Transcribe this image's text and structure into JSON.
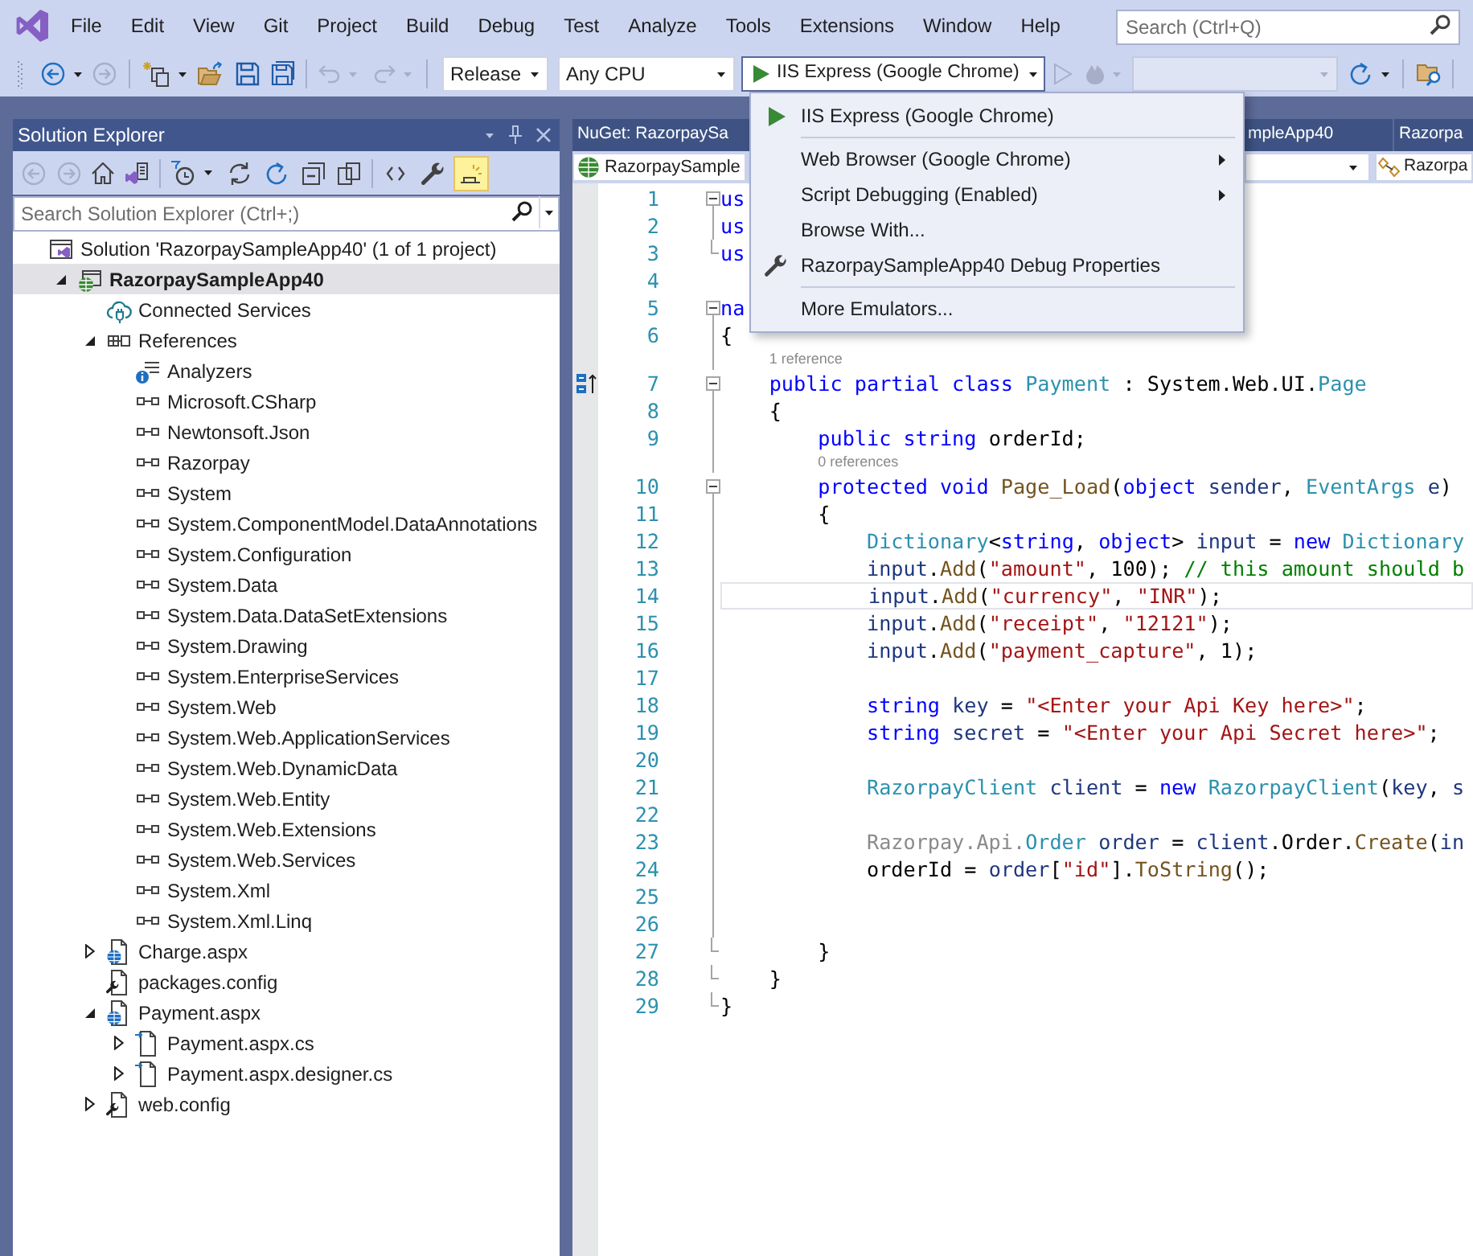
{
  "menu_bar": {
    "items": [
      "File",
      "Edit",
      "View",
      "Git",
      "Project",
      "Build",
      "Debug",
      "Test",
      "Analyze",
      "Tools",
      "Extensions",
      "Window",
      "Help"
    ],
    "search": {
      "placeholder": "Search (Ctrl+Q)"
    }
  },
  "toolbar": {
    "navigate_back": {
      "disabled": false
    },
    "navigate_forward": {
      "disabled": true
    },
    "undo": {
      "disabled": true
    },
    "redo": {
      "disabled": true
    },
    "configuration": {
      "value": "Release"
    },
    "platform": {
      "value": "Any CPU"
    },
    "run": {
      "label": "IIS Express (Google Chrome)",
      "expanded": true
    },
    "start_without_debugging": {
      "disabled": true
    },
    "hot_reload": {
      "disabled": true
    },
    "debug_target": {
      "disabled": true
    }
  },
  "run_menu": {
    "items": [
      {
        "kind": "launch",
        "label": "IIS Express (Google Chrome)",
        "submenu": false
      },
      {
        "kind": "separator"
      },
      {
        "kind": "command",
        "label": "Web Browser (Google Chrome)",
        "submenu": true
      },
      {
        "kind": "command",
        "label": "Script Debugging (Enabled)",
        "submenu": true
      },
      {
        "kind": "command",
        "label": "Browse With...",
        "submenu": false
      },
      {
        "kind": "properties",
        "label": "RazorpaySampleApp40 Debug Properties",
        "submenu": false
      },
      {
        "kind": "separator"
      },
      {
        "kind": "command",
        "label": "More Emulators...",
        "submenu": false
      }
    ]
  },
  "solution_explorer": {
    "title": "Solution Explorer",
    "toolbar": {
      "back": {
        "disabled": true
      },
      "forward": {
        "disabled": true
      },
      "preview_selected_items": {
        "on": true
      }
    },
    "search": {
      "placeholder": "Search Solution Explorer (Ctrl+;)"
    },
    "tree": [
      {
        "label": "Solution 'RazorpaySampleApp40' (1 of 1 project)",
        "kind": "solution",
        "selected": false,
        "children": [
          {
            "label": "RazorpaySampleApp40",
            "kind": "web-project",
            "selected": true,
            "expanded": true,
            "children": [
              {
                "label": "Connected Services",
                "kind": "connected-services",
                "selected": false
              },
              {
                "label": "References",
                "kind": "references",
                "selected": false,
                "expanded": true,
                "children": [
                  {
                    "label": "Analyzers",
                    "kind": "analyzers",
                    "selected": false
                  },
                  {
                    "label": "Microsoft.CSharp",
                    "kind": "assembly",
                    "selected": false
                  },
                  {
                    "label": "Newtonsoft.Json",
                    "kind": "assembly",
                    "selected": false
                  },
                  {
                    "label": "Razorpay",
                    "kind": "assembly",
                    "selected": false
                  },
                  {
                    "label": "System",
                    "kind": "assembly",
                    "selected": false
                  },
                  {
                    "label": "System.ComponentModel.DataAnnotations",
                    "kind": "assembly",
                    "selected": false
                  },
                  {
                    "label": "System.Configuration",
                    "kind": "assembly",
                    "selected": false
                  },
                  {
                    "label": "System.Data",
                    "kind": "assembly",
                    "selected": false
                  },
                  {
                    "label": "System.Data.DataSetExtensions",
                    "kind": "assembly",
                    "selected": false
                  },
                  {
                    "label": "System.Drawing",
                    "kind": "assembly",
                    "selected": false
                  },
                  {
                    "label": "System.EnterpriseServices",
                    "kind": "assembly",
                    "selected": false
                  },
                  {
                    "label": "System.Web",
                    "kind": "assembly",
                    "selected": false
                  },
                  {
                    "label": "System.Web.ApplicationServices",
                    "kind": "assembly",
                    "selected": false
                  },
                  {
                    "label": "System.Web.DynamicData",
                    "kind": "assembly",
                    "selected": false
                  },
                  {
                    "label": "System.Web.Entity",
                    "kind": "assembly",
                    "selected": false
                  },
                  {
                    "label": "System.Web.Extensions",
                    "kind": "assembly",
                    "selected": false
                  },
                  {
                    "label": "System.Web.Services",
                    "kind": "assembly",
                    "selected": false
                  },
                  {
                    "label": "System.Xml",
                    "kind": "assembly",
                    "selected": false
                  },
                  {
                    "label": "System.Xml.Linq",
                    "kind": "assembly",
                    "selected": false
                  }
                ]
              },
              {
                "label": "Charge.aspx",
                "kind": "web-file",
                "selected": false,
                "expanded": false
              },
              {
                "label": "packages.config",
                "kind": "config-file",
                "selected": false
              },
              {
                "label": "Payment.aspx",
                "kind": "web-file",
                "selected": false,
                "expanded": true,
                "children": [
                  {
                    "label": "Payment.aspx.cs",
                    "kind": "code-file",
                    "selected": false,
                    "expanded": false
                  },
                  {
                    "label": "Payment.aspx.designer.cs",
                    "kind": "code-file",
                    "selected": false,
                    "expanded": false
                  }
                ]
              },
              {
                "label": "web.config",
                "kind": "config-file",
                "selected": false,
                "expanded": false
              }
            ]
          }
        ]
      }
    ]
  },
  "editor": {
    "tabs": [
      {
        "label": "NuGet: RazorpaySa",
        "selected": false
      },
      {
        "label": "mpleApp40",
        "selected": false
      },
      {
        "label": "Razorpa",
        "selected": false
      }
    ],
    "navigation": {
      "project": "RazorpaySample",
      "member": "Razorpa"
    },
    "lines": [
      {
        "kind": "code",
        "number": "1",
        "tokens": [
          {
            "text": "us",
            "kind": "keyword"
          }
        ],
        "expanded": true,
        "fold_end": false,
        "current": false,
        "marker": false
      },
      {
        "kind": "code",
        "number": "2",
        "tokens": [
          {
            "text": "us",
            "kind": "keyword"
          }
        ],
        "fold_end": false,
        "current": false,
        "marker": false
      },
      {
        "kind": "code",
        "number": "3",
        "tokens": [
          {
            "text": "us",
            "kind": "keyword"
          }
        ],
        "fold_end": true,
        "current": false,
        "marker": false
      },
      {
        "kind": "code",
        "number": "4",
        "fold_end": false,
        "current": false,
        "marker": false
      },
      {
        "kind": "code",
        "number": "5",
        "tokens": [
          {
            "text": "na",
            "kind": "keyword"
          }
        ],
        "expanded": true,
        "fold_end": false,
        "current": false,
        "marker": false
      },
      {
        "kind": "code",
        "number": "6",
        "tokens": [
          {
            "text": "{",
            "kind": "plain"
          }
        ],
        "fold_end": false,
        "current": false,
        "marker": false,
        "children": [
          {
            "kind": "codelens",
            "text": "1 reference"
          },
          {
            "kind": "code",
            "number": "7",
            "tokens": [
              {
                "text": "public partial class ",
                "kind": "keyword"
              },
              {
                "text": "Payment",
                "kind": "type"
              },
              {
                "text": " : System.Web.UI.",
                "kind": "plain"
              },
              {
                "text": "Page",
                "kind": "type"
              }
            ],
            "expanded": true,
            "fold_end": false,
            "current": false,
            "marker": true
          },
          {
            "kind": "code",
            "number": "8",
            "tokens": [
              {
                "text": "{",
                "kind": "plain"
              }
            ],
            "fold_end": false,
            "current": false,
            "marker": false,
            "children": [
              {
                "kind": "code",
                "number": "9",
                "tokens": [
                  {
                    "text": "public string",
                    "kind": "keyword"
                  },
                  {
                    "text": " orderId;",
                    "kind": "plain"
                  }
                ],
                "fold_end": false,
                "current": false,
                "marker": false
              },
              {
                "kind": "codelens",
                "text": "0 references"
              },
              {
                "kind": "code",
                "number": "10",
                "tokens": [
                  {
                    "text": "protected void ",
                    "kind": "keyword"
                  },
                  {
                    "text": "Page_Load",
                    "kind": "method"
                  },
                  {
                    "text": "(",
                    "kind": "plain"
                  },
                  {
                    "text": "object ",
                    "kind": "keyword"
                  },
                  {
                    "text": "sender",
                    "kind": "local"
                  },
                  {
                    "text": ", ",
                    "kind": "plain"
                  },
                  {
                    "text": "EventArgs ",
                    "kind": "type"
                  },
                  {
                    "text": "e",
                    "kind": "local"
                  },
                  {
                    "text": ")",
                    "kind": "plain"
                  }
                ],
                "expanded": true,
                "fold_end": false,
                "current": false,
                "marker": false
              },
              {
                "kind": "code",
                "number": "11",
                "tokens": [
                  {
                    "text": "{",
                    "kind": "plain"
                  }
                ],
                "fold_end": false,
                "current": false,
                "marker": false,
                "children": [
                  {
                    "kind": "code",
                    "number": "12",
                    "tokens": [
                      {
                        "text": "Dictionary",
                        "kind": "type"
                      },
                      {
                        "text": "<",
                        "kind": "plain"
                      },
                      {
                        "text": "string",
                        "kind": "keyword"
                      },
                      {
                        "text": ", ",
                        "kind": "plain"
                      },
                      {
                        "text": "object",
                        "kind": "keyword"
                      },
                      {
                        "text": "> ",
                        "kind": "plain"
                      },
                      {
                        "text": "input",
                        "kind": "local"
                      },
                      {
                        "text": " = ",
                        "kind": "plain"
                      },
                      {
                        "text": "new ",
                        "kind": "keyword"
                      },
                      {
                        "text": "Dictionary",
                        "kind": "type"
                      }
                    ],
                    "fold_end": false,
                    "current": false,
                    "marker": false
                  },
                  {
                    "kind": "code",
                    "number": "13",
                    "tokens": [
                      {
                        "text": "input",
                        "kind": "local"
                      },
                      {
                        "text": ".",
                        "kind": "plain"
                      },
                      {
                        "text": "Add",
                        "kind": "method"
                      },
                      {
                        "text": "(",
                        "kind": "plain"
                      },
                      {
                        "text": "\"amount\"",
                        "kind": "string"
                      },
                      {
                        "text": ", 100); ",
                        "kind": "plain"
                      },
                      {
                        "text": "// this amount should b",
                        "kind": "comment"
                      }
                    ],
                    "fold_end": false,
                    "current": false,
                    "marker": false
                  },
                  {
                    "kind": "code",
                    "number": "14",
                    "tokens": [
                      {
                        "text": "input",
                        "kind": "local"
                      },
                      {
                        "text": ".",
                        "kind": "plain"
                      },
                      {
                        "text": "Add",
                        "kind": "method"
                      },
                      {
                        "text": "(",
                        "kind": "plain"
                      },
                      {
                        "text": "\"currency\"",
                        "kind": "string"
                      },
                      {
                        "text": ", ",
                        "kind": "plain"
                      },
                      {
                        "text": "\"INR\"",
                        "kind": "string"
                      },
                      {
                        "text": ");",
                        "kind": "plain"
                      }
                    ],
                    "fold_end": false,
                    "current": true,
                    "marker": false
                  },
                  {
                    "kind": "code",
                    "number": "15",
                    "tokens": [
                      {
                        "text": "input",
                        "kind": "local"
                      },
                      {
                        "text": ".",
                        "kind": "plain"
                      },
                      {
                        "text": "Add",
                        "kind": "method"
                      },
                      {
                        "text": "(",
                        "kind": "plain"
                      },
                      {
                        "text": "\"receipt\"",
                        "kind": "string"
                      },
                      {
                        "text": ", ",
                        "kind": "plain"
                      },
                      {
                        "text": "\"12121\"",
                        "kind": "string"
                      },
                      {
                        "text": ");",
                        "kind": "plain"
                      }
                    ],
                    "fold_end": false,
                    "current": false,
                    "marker": false
                  },
                  {
                    "kind": "code",
                    "number": "16",
                    "tokens": [
                      {
                        "text": "input",
                        "kind": "local"
                      },
                      {
                        "text": ".",
                        "kind": "plain"
                      },
                      {
                        "text": "Add",
                        "kind": "method"
                      },
                      {
                        "text": "(",
                        "kind": "plain"
                      },
                      {
                        "text": "\"payment_capture\"",
                        "kind": "string"
                      },
                      {
                        "text": ", 1);",
                        "kind": "plain"
                      }
                    ],
                    "fold_end": false,
                    "current": false,
                    "marker": false
                  },
                  {
                    "kind": "code",
                    "number": "17",
                    "fold_end": false,
                    "current": false,
                    "marker": false
                  },
                  {
                    "kind": "code",
                    "number": "18",
                    "tokens": [
                      {
                        "text": "string ",
                        "kind": "keyword"
                      },
                      {
                        "text": "key",
                        "kind": "local"
                      },
                      {
                        "text": " = ",
                        "kind": "plain"
                      },
                      {
                        "text": "\"<Enter your Api Key here>\"",
                        "kind": "string"
                      },
                      {
                        "text": ";",
                        "kind": "plain"
                      }
                    ],
                    "fold_end": false,
                    "current": false,
                    "marker": false
                  },
                  {
                    "kind": "code",
                    "number": "19",
                    "tokens": [
                      {
                        "text": "string ",
                        "kind": "keyword"
                      },
                      {
                        "text": "secret",
                        "kind": "local"
                      },
                      {
                        "text": " = ",
                        "kind": "plain"
                      },
                      {
                        "text": "\"<Enter your Api Secret here>\"",
                        "kind": "string"
                      },
                      {
                        "text": ";",
                        "kind": "plain"
                      }
                    ],
                    "fold_end": false,
                    "current": false,
                    "marker": false
                  },
                  {
                    "kind": "code",
                    "number": "20",
                    "fold_end": false,
                    "current": false,
                    "marker": false
                  },
                  {
                    "kind": "code",
                    "number": "21",
                    "tokens": [
                      {
                        "text": "RazorpayClient ",
                        "kind": "type"
                      },
                      {
                        "text": "client",
                        "kind": "local"
                      },
                      {
                        "text": " = ",
                        "kind": "plain"
                      },
                      {
                        "text": "new ",
                        "kind": "keyword"
                      },
                      {
                        "text": "RazorpayClient",
                        "kind": "type"
                      },
                      {
                        "text": "(",
                        "kind": "plain"
                      },
                      {
                        "text": "key",
                        "kind": "local"
                      },
                      {
                        "text": ", ",
                        "kind": "plain"
                      },
                      {
                        "text": "s",
                        "kind": "local"
                      }
                    ],
                    "fold_end": false,
                    "current": false,
                    "marker": false
                  },
                  {
                    "kind": "code",
                    "number": "22",
                    "fold_end": false,
                    "current": false,
                    "marker": false
                  },
                  {
                    "kind": "code",
                    "number": "23",
                    "tokens": [
                      {
                        "text": "Razorpay.Api.",
                        "kind": "dim"
                      },
                      {
                        "text": "Order ",
                        "kind": "type"
                      },
                      {
                        "text": "order",
                        "kind": "local"
                      },
                      {
                        "text": " = ",
                        "kind": "plain"
                      },
                      {
                        "text": "client",
                        "kind": "local"
                      },
                      {
                        "text": ".Order.",
                        "kind": "plain"
                      },
                      {
                        "text": "Create",
                        "kind": "method"
                      },
                      {
                        "text": "(",
                        "kind": "plain"
                      },
                      {
                        "text": "in",
                        "kind": "local"
                      }
                    ],
                    "fold_end": false,
                    "current": false,
                    "marker": false
                  },
                  {
                    "kind": "code",
                    "number": "24",
                    "tokens": [
                      {
                        "text": "orderId",
                        "kind": "plain"
                      },
                      {
                        "text": " = ",
                        "kind": "plain"
                      },
                      {
                        "text": "order",
                        "kind": "local"
                      },
                      {
                        "text": "[",
                        "kind": "plain"
                      },
                      {
                        "text": "\"id\"",
                        "kind": "string"
                      },
                      {
                        "text": "].",
                        "kind": "plain"
                      },
                      {
                        "text": "ToString",
                        "kind": "method"
                      },
                      {
                        "text": "();",
                        "kind": "plain"
                      }
                    ],
                    "fold_end": false,
                    "current": false,
                    "marker": false
                  },
                  {
                    "kind": "code",
                    "number": "25",
                    "fold_end": false,
                    "current": false,
                    "marker": false
                  },
                  {
                    "kind": "code",
                    "number": "26",
                    "fold_end": false,
                    "current": false,
                    "marker": false
                  }
                ]
              },
              {
                "kind": "code",
                "number": "27",
                "tokens": [
                  {
                    "text": "}",
                    "kind": "plain"
                  }
                ],
                "fold_end": true,
                "current": false,
                "marker": false
              }
            ]
          },
          {
            "kind": "code",
            "number": "28",
            "tokens": [
              {
                "text": "}",
                "kind": "plain"
              }
            ],
            "fold_end": true,
            "current": false,
            "marker": false
          }
        ]
      },
      {
        "kind": "code",
        "number": "29",
        "tokens": [
          {
            "text": "}",
            "kind": "plain"
          }
        ],
        "fold_end": true,
        "current": false,
        "marker": false
      }
    ]
  }
}
